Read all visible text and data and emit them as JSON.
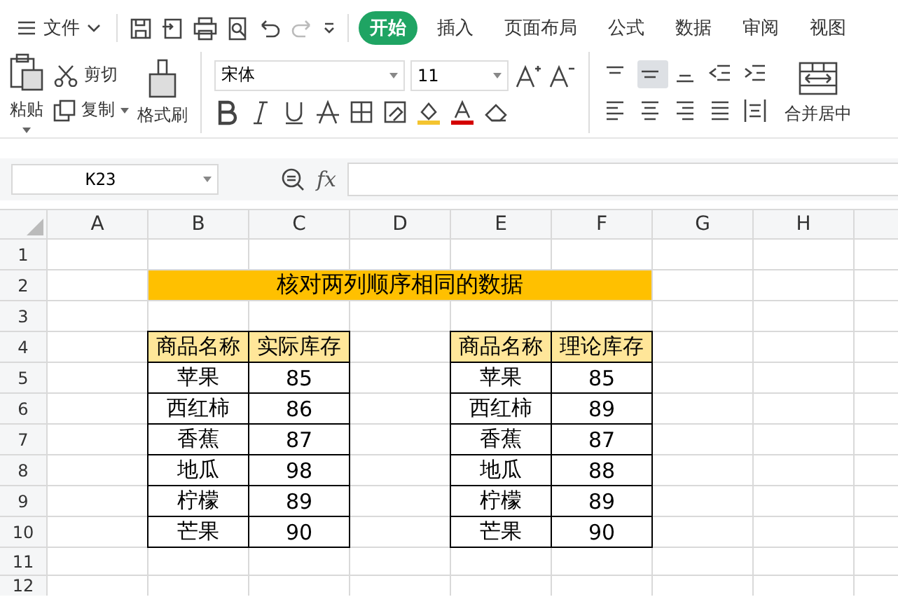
{
  "menu": {
    "file_label": "文件",
    "tabs": [
      {
        "label": "开始",
        "selected": true
      },
      {
        "label": "插入",
        "selected": false
      },
      {
        "label": "页面布局",
        "selected": false
      },
      {
        "label": "公式",
        "selected": false
      },
      {
        "label": "数据",
        "selected": false
      },
      {
        "label": "审阅",
        "selected": false
      },
      {
        "label": "视图",
        "selected": false
      }
    ]
  },
  "ribbon": {
    "paste": "粘贴",
    "cut": "剪切",
    "copy": "复制",
    "format_painter": "格式刷",
    "font_name": "宋体",
    "font_size": "11",
    "merge_center": "合并居中",
    "align_buttons": [
      {
        "selected": false
      },
      {
        "selected": true
      },
      {
        "selected": false
      },
      {
        "selected": false
      },
      {
        "selected": false
      }
    ]
  },
  "formula_bar": {
    "name_box": "K23",
    "fx": "fx"
  },
  "sheet": {
    "columns": [
      "A",
      "B",
      "C",
      "D",
      "E",
      "F",
      "G",
      "H"
    ],
    "rows": [
      "1",
      "2",
      "3",
      "4",
      "5",
      "6",
      "7",
      "8",
      "9",
      "10",
      "11",
      "12"
    ],
    "title": "核对两列顺序相同的数据",
    "tables": [
      {
        "columns": [
          "商品名称",
          "实际库存"
        ],
        "rows": [
          [
            "苹果",
            "85"
          ],
          [
            "西红柿",
            "86"
          ],
          [
            "香蕉",
            "87"
          ],
          [
            "地瓜",
            "98"
          ],
          [
            "柠檬",
            "89"
          ],
          [
            "芒果",
            "90"
          ]
        ]
      },
      {
        "columns": [
          "商品名称",
          "理论库存"
        ],
        "rows": [
          [
            "苹果",
            "85"
          ],
          [
            "西红柿",
            "89"
          ],
          [
            "香蕉",
            "87"
          ],
          [
            "地瓜",
            "88"
          ],
          [
            "柠檬",
            "89"
          ],
          [
            "芒果",
            "90"
          ]
        ]
      }
    ]
  }
}
